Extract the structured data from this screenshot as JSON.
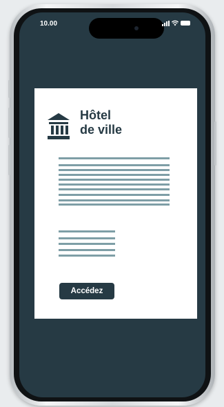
{
  "status_bar": {
    "time": "10.00",
    "icons": [
      "signal-icon",
      "wifi-icon",
      "battery-icon"
    ]
  },
  "card": {
    "logo_icon": "town-hall-icon",
    "title_line1": "Hôtel",
    "title_line2": "de ville",
    "button_label": "Accédez"
  },
  "colors": {
    "screen_background": "#263a44",
    "card_background": "#ffffff",
    "accent": "#263a44",
    "text_placeholder_lines": "#7e9ea6"
  }
}
